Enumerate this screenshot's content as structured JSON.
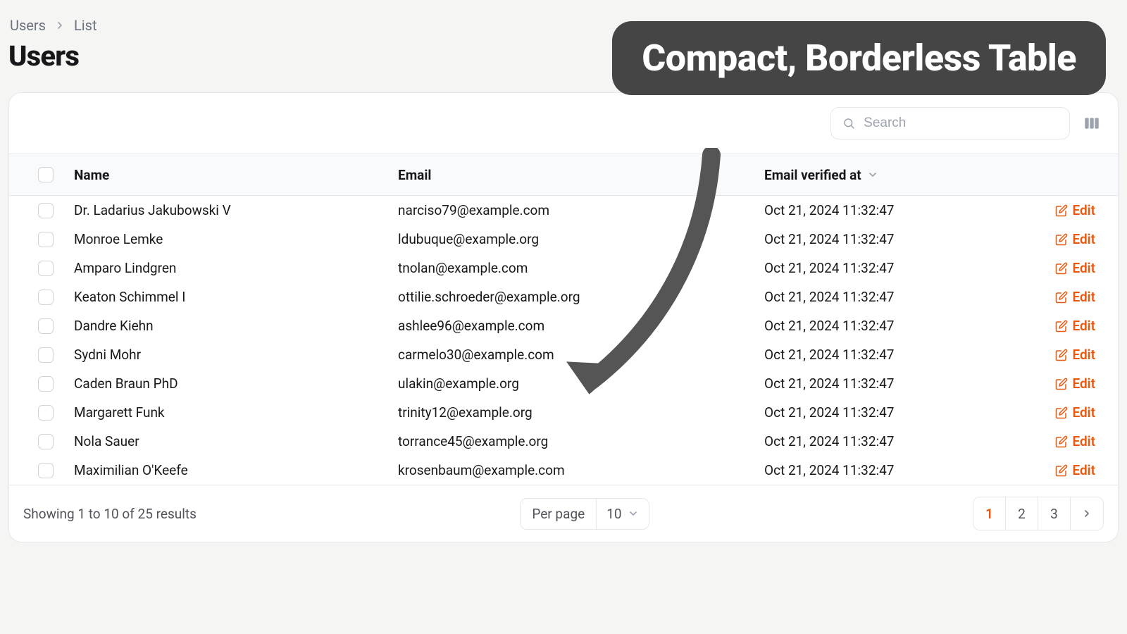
{
  "breadcrumb": {
    "root": "Users",
    "current": "List"
  },
  "page": {
    "title": "Users"
  },
  "toolbar": {
    "search_placeholder": "Search"
  },
  "columns": {
    "name": "Name",
    "email": "Email",
    "verified": "Email verified at"
  },
  "rows": [
    {
      "name": "Dr. Ladarius Jakubowski V",
      "email": "narciso79@example.com",
      "verified": "Oct 21, 2024 11:32:47",
      "action": "Edit"
    },
    {
      "name": "Monroe Lemke",
      "email": "ldubuque@example.org",
      "verified": "Oct 21, 2024 11:32:47",
      "action": "Edit"
    },
    {
      "name": "Amparo Lindgren",
      "email": "tnolan@example.com",
      "verified": "Oct 21, 2024 11:32:47",
      "action": "Edit"
    },
    {
      "name": "Keaton Schimmel I",
      "email": "ottilie.schroeder@example.org",
      "verified": "Oct 21, 2024 11:32:47",
      "action": "Edit"
    },
    {
      "name": "Dandre Kiehn",
      "email": "ashlee96@example.com",
      "verified": "Oct 21, 2024 11:32:47",
      "action": "Edit"
    },
    {
      "name": "Sydni Mohr",
      "email": "carmelo30@example.com",
      "verified": "Oct 21, 2024 11:32:47",
      "action": "Edit"
    },
    {
      "name": "Caden Braun PhD",
      "email": "ulakin@example.org",
      "verified": "Oct 21, 2024 11:32:47",
      "action": "Edit"
    },
    {
      "name": "Margarett Funk",
      "email": "trinity12@example.org",
      "verified": "Oct 21, 2024 11:32:47",
      "action": "Edit"
    },
    {
      "name": "Nola Sauer",
      "email": "torrance45@example.org",
      "verified": "Oct 21, 2024 11:32:47",
      "action": "Edit"
    },
    {
      "name": "Maximilian O'Keefe",
      "email": "krosenbaum@example.com",
      "verified": "Oct 21, 2024 11:32:47",
      "action": "Edit"
    }
  ],
  "footer": {
    "summary": "Showing 1 to 10 of 25 results",
    "per_page_label": "Per page",
    "per_page_value": "10",
    "pages": [
      "1",
      "2",
      "3"
    ],
    "active_page": "1"
  },
  "annotation": {
    "text": "Compact, Borderless Table"
  }
}
